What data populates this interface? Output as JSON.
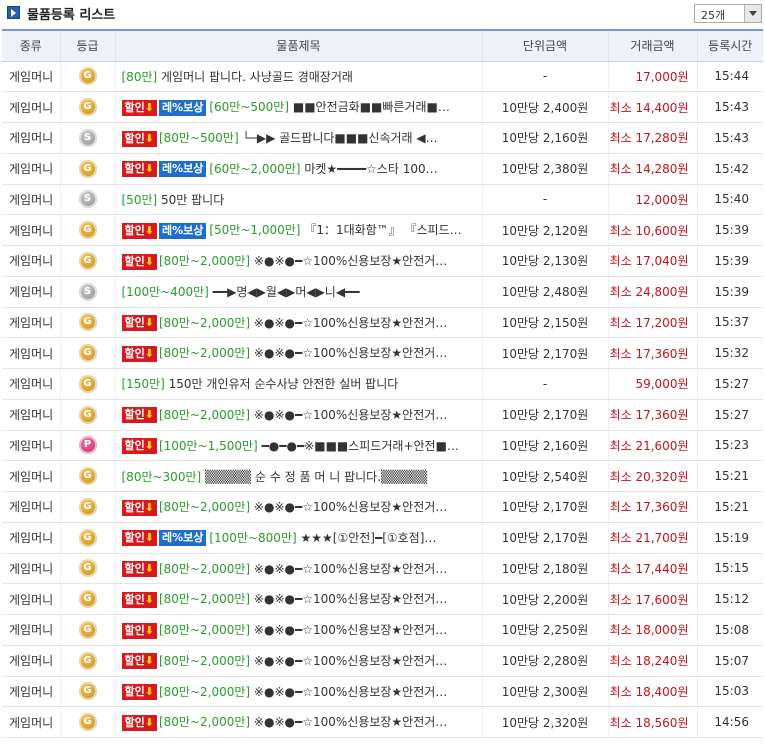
{
  "header": {
    "title": "물품등록 리스트",
    "page_size": "25개"
  },
  "columns": [
    "종류",
    "등급",
    "물품제목",
    "단위금액",
    "거래금액",
    "등록시간"
  ],
  "rows": [
    {
      "kind": "게임머니",
      "grade": "G",
      "sale": "",
      "comp": "",
      "range": "[80만]",
      "title": "게임머니 팝니다. 사냥골드 경매장거래",
      "unit": "-",
      "price": "17,000원",
      "time": "15:44"
    },
    {
      "kind": "게임머니",
      "grade": "G",
      "sale": "할인⬇",
      "comp": "레%보상",
      "range": "[60만~500만]",
      "title": "■■안전금화■■빠른거래■…",
      "unit": "10만당 2,400원",
      "price": "최소 14,400원",
      "time": "15:43"
    },
    {
      "kind": "게임머니",
      "grade": "S",
      "sale": "할인⬇",
      "comp": "",
      "range": "[80만~500만]",
      "title": "└─▶▶ 골드팝니다■■■신속거래 ◀…",
      "unit": "10만당 2,160원",
      "price": "최소 17,280원",
      "time": "15:43"
    },
    {
      "kind": "게임머니",
      "grade": "G",
      "sale": "할인⬇",
      "comp": "레%보상",
      "range": "[60만~2,000만]",
      "title": "마켓★━━━━☆스타 100…",
      "unit": "10만당 2,380원",
      "price": "최소 14,280원",
      "time": "15:42"
    },
    {
      "kind": "게임머니",
      "grade": "S",
      "sale": "",
      "comp": "",
      "range": "[50만]",
      "title": "50만 팝니다",
      "unit": "-",
      "price": "12,000원",
      "time": "15:40"
    },
    {
      "kind": "게임머니",
      "grade": "G",
      "sale": "할인⬇",
      "comp": "레%보상",
      "range": "[50만~1,000만]",
      "title": "『1：1대화함™』 『스피드…",
      "unit": "10만당 2,120원",
      "price": "최소 10,600원",
      "time": "15:39"
    },
    {
      "kind": "게임머니",
      "grade": "G",
      "sale": "할인⬇",
      "comp": "",
      "range": "[80만~2,000만]",
      "title": "※●※●━☆100%신용보장★안전거…",
      "unit": "10만당 2,130원",
      "price": "최소 17,040원",
      "time": "15:39"
    },
    {
      "kind": "게임머니",
      "grade": "S",
      "sale": "",
      "comp": "",
      "range": "[100만~400만]",
      "title": "━━▶명◀▶월◀▶머◀▶니◀━━",
      "unit": "10만당 2,480원",
      "price": "최소 24,800원",
      "time": "15:39"
    },
    {
      "kind": "게임머니",
      "grade": "G",
      "sale": "할인⬇",
      "comp": "",
      "range": "[80만~2,000만]",
      "title": "※●※●━☆100%신용보장★안전거…",
      "unit": "10만당 2,150원",
      "price": "최소 17,200원",
      "time": "15:37"
    },
    {
      "kind": "게임머니",
      "grade": "G",
      "sale": "할인⬇",
      "comp": "",
      "range": "[80만~2,000만]",
      "title": "※●※●━☆100%신용보장★안전거…",
      "unit": "10만당 2,170원",
      "price": "최소 17,360원",
      "time": "15:32"
    },
    {
      "kind": "게임머니",
      "grade": "G",
      "sale": "",
      "comp": "",
      "range": "[150만]",
      "title": "150만 개인유저 순수사냥 안전한 실버 팝니다",
      "unit": "-",
      "price": "59,000원",
      "time": "15:27"
    },
    {
      "kind": "게임머니",
      "grade": "G",
      "sale": "할인⬇",
      "comp": "",
      "range": "[80만~2,000만]",
      "title": "※●※●━☆100%신용보장★안전거…",
      "unit": "10만당 2,170원",
      "price": "최소 17,360원",
      "time": "15:27"
    },
    {
      "kind": "게임머니",
      "grade": "P",
      "sale": "할인⬇",
      "comp": "",
      "range": "[100만~1,500만]",
      "title": "━●━●━※■■■스피드거래+안전■…",
      "unit": "10만당 2,160원",
      "price": "최소 21,600원",
      "time": "15:23"
    },
    {
      "kind": "게임머니",
      "grade": "G",
      "sale": "",
      "comp": "",
      "range": "[80만~300만]",
      "title": "▒▒▒▒▒ 순 수 정 품 머 니 팝니다.▒▒▒▒▒",
      "unit": "10만당 2,540원",
      "price": "최소 20,320원",
      "time": "15:21"
    },
    {
      "kind": "게임머니",
      "grade": "G",
      "sale": "할인⬇",
      "comp": "",
      "range": "[80만~2,000만]",
      "title": "※●※●━☆100%신용보장★안전거…",
      "unit": "10만당 2,170원",
      "price": "최소 17,360원",
      "time": "15:21"
    },
    {
      "kind": "게임머니",
      "grade": "G",
      "sale": "할인⬇",
      "comp": "레%보상",
      "range": "[100만~800만]",
      "title": "★★★[①안전]━[①호점]…",
      "unit": "10만당 2,170원",
      "price": "최소 21,700원",
      "time": "15:19"
    },
    {
      "kind": "게임머니",
      "grade": "G",
      "sale": "할인⬇",
      "comp": "",
      "range": "[80만~2,000만]",
      "title": "※●※●━☆100%신용보장★안전거…",
      "unit": "10만당 2,180원",
      "price": "최소 17,440원",
      "time": "15:15"
    },
    {
      "kind": "게임머니",
      "grade": "G",
      "sale": "할인⬇",
      "comp": "",
      "range": "[80만~2,000만]",
      "title": "※●※●━☆100%신용보장★안전거…",
      "unit": "10만당 2,200원",
      "price": "최소 17,600원",
      "time": "15:12"
    },
    {
      "kind": "게임머니",
      "grade": "G",
      "sale": "할인⬇",
      "comp": "",
      "range": "[80만~2,000만]",
      "title": "※●※●━☆100%신용보장★안전거…",
      "unit": "10만당 2,250원",
      "price": "최소 18,000원",
      "time": "15:08"
    },
    {
      "kind": "게임머니",
      "grade": "G",
      "sale": "할인⬇",
      "comp": "",
      "range": "[80만~2,000만]",
      "title": "※●※●━☆100%신용보장★안전거…",
      "unit": "10만당 2,280원",
      "price": "최소 18,240원",
      "time": "15:07"
    },
    {
      "kind": "게임머니",
      "grade": "G",
      "sale": "할인⬇",
      "comp": "",
      "range": "[80만~2,000만]",
      "title": "※●※●━☆100%신용보장★안전거…",
      "unit": "10만당 2,300원",
      "price": "최소 18,400원",
      "time": "15:03"
    },
    {
      "kind": "게임머니",
      "grade": "G",
      "sale": "할인⬇",
      "comp": "",
      "range": "[80만~2,000만]",
      "title": "※●※●━☆100%신용보장★안전거…",
      "unit": "10만당 2,320원",
      "price": "최소 18,560원",
      "time": "14:56"
    }
  ]
}
